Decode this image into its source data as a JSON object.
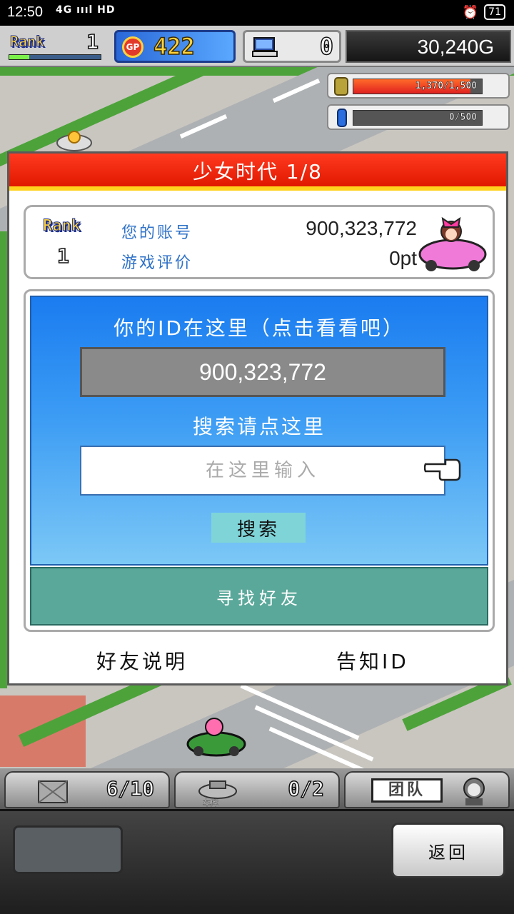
{
  "status_bar": {
    "time": "12:50",
    "network": "4G ıııl HD",
    "battery": "71"
  },
  "hud": {
    "rank_label": "Rank",
    "rank_value": "1",
    "rank_progress": 0.22,
    "gp_icon": "GP",
    "gp_value": "422",
    "computer_value": "0",
    "money": "30,240G"
  },
  "meters": {
    "fuel": {
      "text": "1,370/1,500",
      "fraction": 0.913
    },
    "energy": {
      "text": "0/500",
      "fraction": 0
    }
  },
  "dialog": {
    "title": "少女时代 1/8",
    "account": {
      "rank_label": "Rank",
      "rank_value": "1",
      "account_label": "您的账号",
      "account_value": "900,323,772",
      "rating_label": "游戏评价",
      "rating_value": "0pt"
    },
    "id_section": {
      "caption": "你的ID在这里（点击看看吧）",
      "id_value": "900,323,772",
      "search_caption": "搜索请点这里",
      "search_placeholder": "在这里输入",
      "search_button": "搜索",
      "find_friend_button": "寻找好友"
    },
    "friend_help": "好友说明",
    "tell_id": "告知ID"
  },
  "bottom_bar": {
    "items_count": "6/10",
    "garage_label": "车库",
    "garage_count": "0/2",
    "team_label": "团队",
    "back_button": "返回"
  },
  "colors": {
    "title_red": "#f01a00",
    "accent_blue": "#2f72c8",
    "teal_button": "#5aa89a"
  }
}
